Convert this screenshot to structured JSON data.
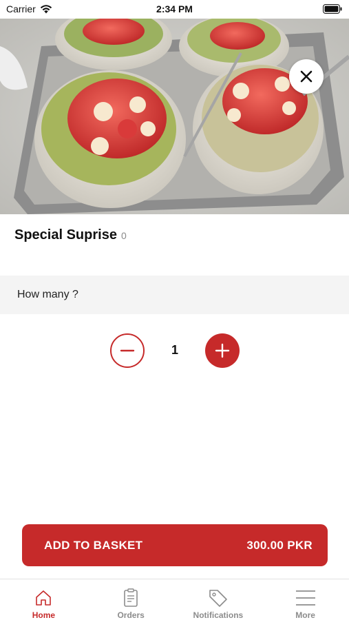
{
  "status_bar": {
    "carrier": "Carrier",
    "time": "2:34 PM"
  },
  "product": {
    "name": "Special Suprise",
    "count": "0",
    "image_icon": "dessert-photo"
  },
  "quantity_section": {
    "label": "How many ?",
    "value": "1"
  },
  "basket": {
    "label": "ADD TO BASKET",
    "price": "300.00 PKR"
  },
  "tabs": [
    {
      "label": "Home",
      "icon": "home-icon",
      "active": true
    },
    {
      "label": "Orders",
      "icon": "orders-icon",
      "active": false
    },
    {
      "label": "Notifications",
      "icon": "tag-icon",
      "active": false
    },
    {
      "label": "More",
      "icon": "menu-icon",
      "active": false
    }
  ],
  "colors": {
    "accent": "#c62a2a",
    "section_bg": "#f4f4f4",
    "inactive_tab": "#8c8c8c"
  }
}
